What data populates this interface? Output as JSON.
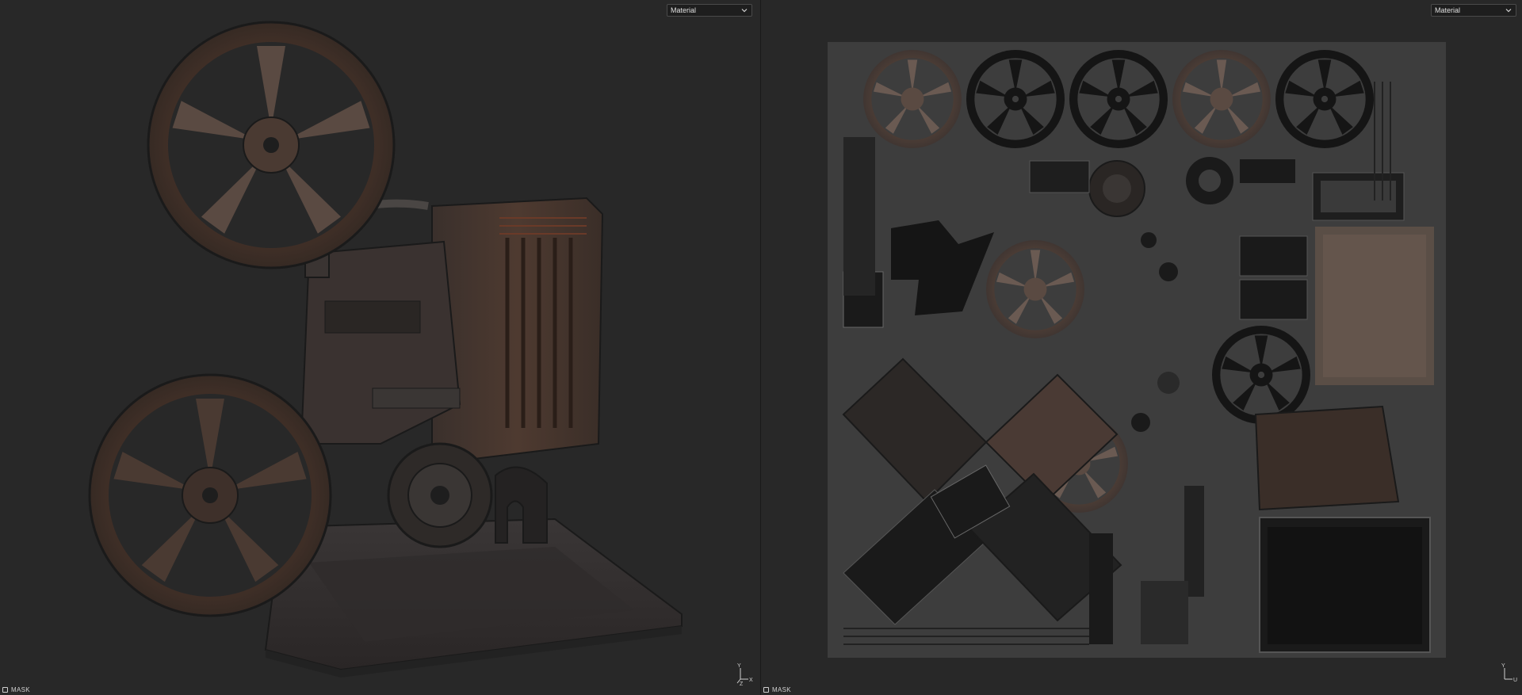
{
  "left_viewport": {
    "mode_dropdown": {
      "value": "Material"
    },
    "status": {
      "mask_label": "MASK"
    },
    "axes": {
      "y": "Y",
      "x": "X",
      "z": "Z"
    }
  },
  "right_viewport": {
    "mode_dropdown": {
      "value": "Material"
    },
    "status": {
      "mask_label": "MASK"
    },
    "axes": {
      "y": "Y",
      "u": "U"
    }
  },
  "colors": {
    "background": "#282828",
    "uv_sheet": "#3d3d3d",
    "rust": "#5a3524",
    "dark_metal": "#1c1c1c",
    "worn_metal": "#6e6e6e"
  },
  "icons": {
    "dropdown": "chevron-down-icon",
    "mask": "checkbox-icon",
    "axis": "axis-gizmo-icon"
  }
}
